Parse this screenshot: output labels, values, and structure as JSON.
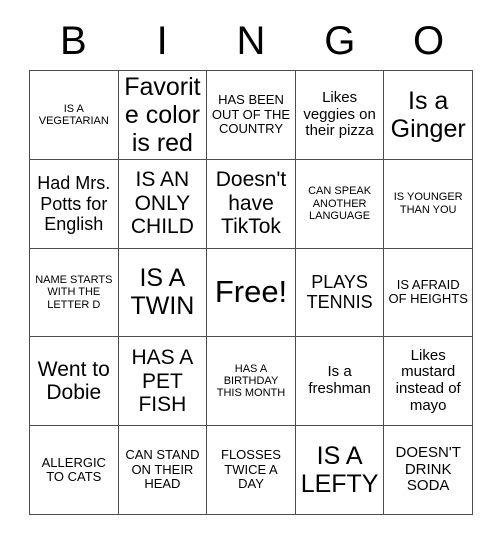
{
  "card": {
    "header_letters": [
      "B",
      "I",
      "N",
      "G",
      "O"
    ],
    "rows": [
      [
        {
          "text": "IS A VEGETARIAN",
          "size": "xs"
        },
        {
          "text": "Favorite color is red",
          "size": "xxl"
        },
        {
          "text": "HAS BEEN OUT OF THE COUNTRY",
          "size": "s"
        },
        {
          "text": "Likes veggies on their pizza",
          "size": "m"
        },
        {
          "text": "Is a Ginger",
          "size": "xxl"
        }
      ],
      [
        {
          "text": "Had Mrs. Potts for English",
          "size": "l"
        },
        {
          "text": "IS AN ONLY CHILD",
          "size": "xl"
        },
        {
          "text": "Doesn't have TikTok",
          "size": "xl"
        },
        {
          "text": "CAN SPEAK ANOTHER LANGUAGE",
          "size": "xs"
        },
        {
          "text": "IS YOUNGER THAN YOU",
          "size": "xs"
        }
      ],
      [
        {
          "text": "NAME STARTS WITH THE LETTER D",
          "size": "xs"
        },
        {
          "text": "IS A TWIN",
          "size": "xxl"
        },
        {
          "text": "Free!",
          "size": "free"
        },
        {
          "text": "PLAYS TENNIS",
          "size": "l"
        },
        {
          "text": "IS AFRAID OF HEIGHTS",
          "size": "s"
        }
      ],
      [
        {
          "text": "Went to Dobie",
          "size": "xl"
        },
        {
          "text": "HAS A PET FISH",
          "size": "xl"
        },
        {
          "text": "HAS A BIRTHDAY THIS MONTH",
          "size": "xs"
        },
        {
          "text": "Is a freshman",
          "size": "m"
        },
        {
          "text": "Likes mustard instead of mayo",
          "size": "m"
        }
      ],
      [
        {
          "text": "ALLERGIC TO CATS",
          "size": "s"
        },
        {
          "text": "CAN STAND ON THEIR HEAD",
          "size": "s"
        },
        {
          "text": "FLOSSES TWICE A DAY",
          "size": "s"
        },
        {
          "text": "IS A LEFTY",
          "size": "xxl"
        },
        {
          "text": "DOESN'T DRINK SODA",
          "size": "m"
        }
      ]
    ],
    "free_space": {
      "row": 2,
      "col": 2,
      "label": "Free!"
    }
  },
  "colors": {
    "background": "#ffffff",
    "text": "#000000",
    "grid_line": "#4d4d4d"
  }
}
